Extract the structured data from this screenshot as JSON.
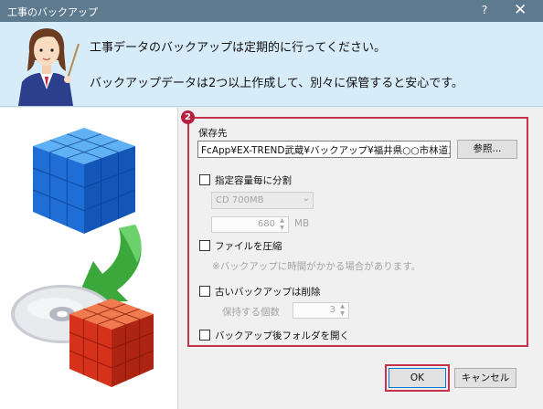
{
  "window": {
    "title": "工事のバックアップ",
    "help": "?",
    "close": "✕"
  },
  "banner": {
    "line1": "工事データのバックアップは定期的に行ってください。",
    "line2": "バックアップデータは2つ以上作成して、別々に保管すると安心です。"
  },
  "callout_badge": "2",
  "save_to": {
    "label": "保存先",
    "path": "FcApp¥EX-TREND武蔵¥バックアップ¥福井県○○市林道工事",
    "browse_label": "参照..."
  },
  "split": {
    "label": "指定容量毎に分割",
    "checked": false,
    "media_option": "CD 700MB",
    "size_value": "680",
    "size_unit": "MB"
  },
  "compress": {
    "label": "ファイルを圧縮",
    "checked": false,
    "note": "※バックアップに時間がかかる場合があります。"
  },
  "delete_old": {
    "label": "古いバックアップは削除",
    "checked": false,
    "keep_label": "保持する個数",
    "keep_value": "3"
  },
  "open_folder": {
    "label": "バックアップ後フォルダを開く",
    "checked": false
  },
  "buttons": {
    "ok": "OK",
    "cancel": "キャンセル"
  }
}
